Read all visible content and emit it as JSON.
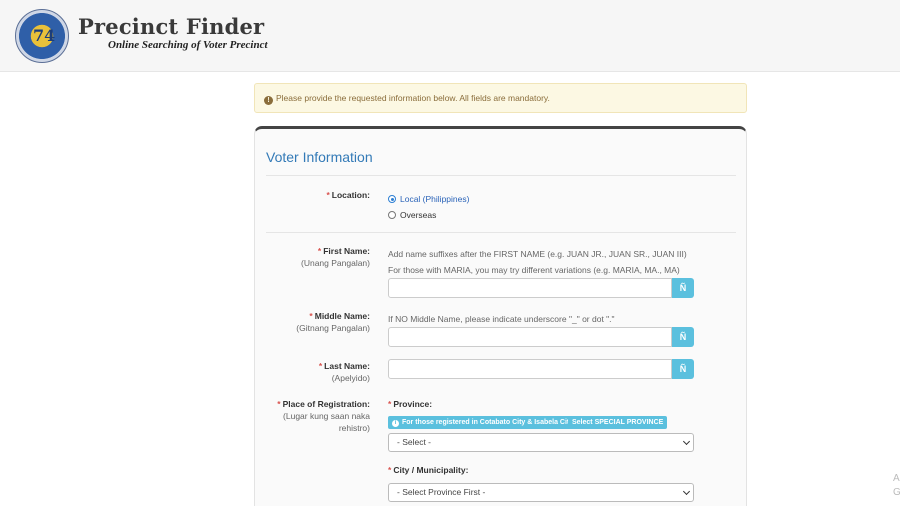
{
  "header": {
    "seal_glyph": "74",
    "title": "Precinct Finder",
    "subtitle": "Online Searching of Voter Precinct"
  },
  "alert": {
    "icon": "info-icon",
    "text": "Please provide the requested information below. All fields are mandatory."
  },
  "panel": {
    "title": "Voter Information"
  },
  "location": {
    "label": "Location:",
    "options": [
      "Local (Philippines)",
      "Overseas"
    ],
    "selected": "Local (Philippines)"
  },
  "first_name": {
    "label": "First Name:",
    "sublabel": "(Unang Pangalan)",
    "help1": "Add name suffixes after the FIRST NAME (e.g. JUAN JR., JUAN SR., JUAN III)",
    "help2": "For those with MARIA, you may try different variations (e.g. MARIA, MA., MA)",
    "value": "",
    "addon": "Ñ"
  },
  "middle_name": {
    "label": "Middle Name:",
    "sublabel": "(Gitnang Pangalan)",
    "help": "If NO Middle Name, please indicate underscore \"_\" or dot \".\"",
    "value": "",
    "addon": "Ñ"
  },
  "last_name": {
    "label": "Last Name:",
    "sublabel": "(Apelyido)",
    "value": "",
    "addon": "Ñ"
  },
  "place": {
    "label": "Place of Registration:",
    "sublabel1": "(Lugar kung saan naka",
    "sublabel2": "rehistro)"
  },
  "province": {
    "label": "Province:",
    "badge_cotabato": "For those registered in Cotabato City & Isabela City",
    "badge_special": "Select SPECIAL PROVINCE",
    "selected": "- Select -"
  },
  "city": {
    "label": "City / Municipality:",
    "selected": "- Select Province First -"
  },
  "watermark": {
    "line1": "A",
    "line2": "G"
  },
  "colors": {
    "accent": "#337ab7",
    "addon": "#5bc0de",
    "required": "#d9534f",
    "alert_bg": "#fcf8e3"
  }
}
